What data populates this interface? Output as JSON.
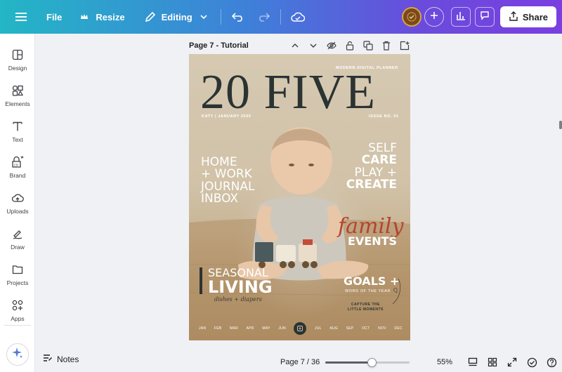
{
  "topbar": {
    "file_label": "File",
    "resize_label": "Resize",
    "editing_label": "Editing",
    "share_label": "Share"
  },
  "sidebar": {
    "items": [
      {
        "label": "Design",
        "icon": "design-icon"
      },
      {
        "label": "Elements",
        "icon": "elements-icon"
      },
      {
        "label": "Text",
        "icon": "text-icon"
      },
      {
        "label": "Brand",
        "icon": "brand-icon"
      },
      {
        "label": "Uploads",
        "icon": "uploads-icon"
      },
      {
        "label": "Draw",
        "icon": "draw-icon"
      },
      {
        "label": "Projects",
        "icon": "projects-icon"
      },
      {
        "label": "Apps",
        "icon": "apps-icon"
      }
    ]
  },
  "page_header": {
    "title": "Page 7 - Tutorial"
  },
  "cover": {
    "top_tag": "MODERN DIGITAL PLANNER",
    "title": "20 FIVE",
    "byline": "KATY | JANUARY 2025",
    "issue": "ISSUE NO. 01",
    "left_lines": [
      "HOME",
      "+ WORK",
      "JOURNAL",
      "INBOX"
    ],
    "right_lines": [
      "SELF",
      "CARE",
      "PLAY +",
      "CREATE"
    ],
    "family": "family",
    "events": "EVENTS",
    "seasonal": "SEASONAL",
    "living": "LIVING",
    "dishes": "dishes + diapers",
    "goals": "GOALS +",
    "word_of_year": "WORD OF THE YEAR",
    "capture_1": "CAPTURE THE",
    "capture_2": "LITTLE MOMENTS",
    "months_left": [
      "JAN",
      "FEB",
      "MAR",
      "APR",
      "MAY",
      "JUN"
    ],
    "months_right": [
      "JUL",
      "AUG",
      "SEP",
      "OCT",
      "NOV",
      "DEC"
    ]
  },
  "bottombar": {
    "notes_label": "Notes",
    "page_count": "Page 7 / 36",
    "zoom_label": "55%",
    "zoom_fraction": 0.55
  },
  "colors": {
    "accent_dark": "#2b3333",
    "script_red": "#b5432e"
  }
}
